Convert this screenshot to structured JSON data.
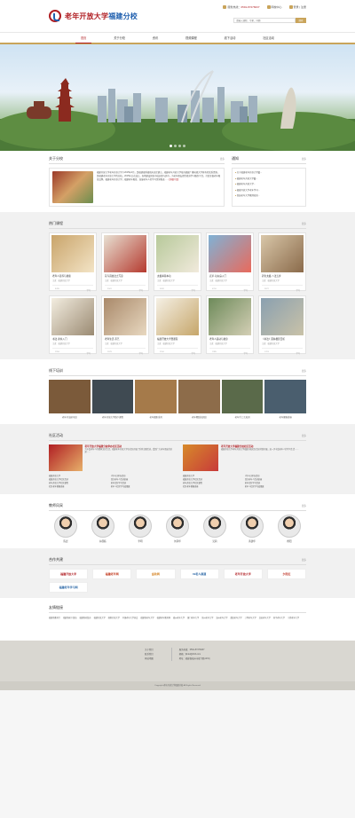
{
  "header": {
    "logo_title": "老年开放大学",
    "logo_sub": "福建分校",
    "phone_label": "服务热线：",
    "phone": "0591-87278237",
    "links": [
      "网校中心",
      "登录 | 注册"
    ],
    "search_placeholder": "请输入课程、专家、问题",
    "search_button": "搜索"
  },
  "nav": [
    "首页",
    "关于分校",
    "资讯",
    "视频课程",
    "线下活动",
    "社区活动"
  ],
  "about": {
    "title": "关于分校",
    "more": "更多",
    "text": "福建开放大学老年开放大学于2015年4月，是福建省委省政府决定建立，福建老年开放大学依托福建广播电视大学原有的优质资源，是福建老年开放大学的分校，2015年正式成立，各地建设团队中成员参与其中，为老年朋友提供终身学习服务平台，打造全省老年教育品牌，福建老年开放大学，福建老年教育，发展老年人的学习需求推进……",
    "read_more": "[详细介绍]"
  },
  "notice": {
    "title": "通知",
    "more": "更多",
    "items": [
      "关于福建老年开放大学暨...",
      "福建老年开放大学暨...",
      "福建老年开放大学...",
      "福建开放大学老年学习...",
      "首届老年大学教师培训..."
    ]
  },
  "courses": {
    "title": "热门课程",
    "more": "更多",
    "items": [
      {
        "t": "老年人营养与健康",
        "s": "主讲：福建开放大学",
        "v": "8435",
        "c": "学习"
      },
      {
        "t": "花鸟画技法之写意",
        "s": "主讲：福建开放大学",
        "v": "3341",
        "c": "学习"
      },
      {
        "t": "太极拳基本功",
        "s": "主讲：福建开放大学",
        "v": "5632",
        "c": "学习"
      },
      {
        "t": "武术·功夫扇入门",
        "s": "主讲：福建开放大学",
        "v": "4210",
        "c": "学习"
      },
      {
        "t": "养生太极·八法五步",
        "s": "主讲：福建开放大学",
        "v": "3672",
        "c": "学习"
      },
      {
        "t": "书法·隶书入门",
        "s": "主讲：福建开放大学",
        "v": "2934",
        "c": "学习"
      },
      {
        "t": "老年生活·茶艺",
        "s": "主讲：福建开放大学",
        "v": "2678",
        "c": "学习"
      },
      {
        "t": "福建开放大学暨课程",
        "s": "主讲：福建开放大学",
        "v": "2190",
        "c": "学习"
      },
      {
        "t": "老年人运动与健身",
        "s": "主讲：福建开放大学",
        "v": "1985",
        "c": "学习"
      },
      {
        "t": "《书法》园林摄影赏析",
        "s": "主讲：福建开放大学",
        "v": "1763",
        "c": "学习"
      }
    ]
  },
  "offline": {
    "title": "线下培训",
    "more": "更多",
    "items": [
      "老年书法研习班",
      "老年开放大学线下课程",
      "老年摄影采风",
      "老年舞蹈培训班",
      "老年手工艺培训",
      "老年健康讲座"
    ]
  },
  "community": {
    "title": "社区活动",
    "more": "更多",
    "left": {
      "h": "老年开放大学福建分校举办社区活动",
      "p": "为丰富老年人的精神文化生活，福建老年开放大学在社区开展了系列主题活动，受到广大老年朋友的欢迎……",
      "list": [
        "福建开放大学",
        "4月20日举办活动",
        "福建开放大学社区活动",
        "社区老年人活动讲座",
        "老年开放大学社区课程",
        "老年社区学习活动",
        "社区老年健康讲座",
        "老年人社区学习成果展"
      ]
    },
    "right": {
      "h": "老年开放大学福建分校社区活动",
      "p": "福建开放大学老年开放大学福建分校社区活动持续开展，进一步丰富老年人的学习生活……",
      "list": [
        "福建开放大学",
        "4月20日举办活动",
        "福建开放大学社区活动",
        "社区老年人活动讲座",
        "老年开放大学社区课程",
        "老年社区学习活动",
        "社区老年健康讲座",
        "老年人社区学习成果展"
      ]
    }
  },
  "teachers": {
    "title": "教师风采",
    "more": "更多",
    "items": [
      "陈晨",
      "林国栋",
      "李明",
      "刘丹华",
      "吴莉",
      "黄建华",
      "杨阳"
    ]
  },
  "partners": {
    "title": "合作共建",
    "more": "更多",
    "items": [
      "福建开放大学",
      "福建老年网",
      "金秋网",
      "39老人频道",
      "老年开放大学",
      "夕阳红",
      "福建老年学习网"
    ]
  },
  "links": {
    "title": "友情链接",
    "items": [
      "福建省教育厅",
      "福建省老干部局",
      "福建省老龄办",
      "福建开放大学",
      "国家开放大学",
      "中国老年大学协会",
      "福建省老年大学",
      "福建老年教育网",
      "福州老年大学",
      "厦门老年大学",
      "泉州老年大学",
      "漳州老年大学",
      "莆田老年大学",
      "三明老年大学",
      "龙岩老年大学",
      "南平老年大学",
      "宁德老年大学"
    ]
  },
  "footer": {
    "left": [
      "关于我们",
      "联系我们",
      "网站地图"
    ],
    "right": [
      "服务热线：0591-87278237",
      "邮箱：fjlnkd@163.com",
      "地址：福建省福州市福飞路123号"
    ],
    "copyright": "Copyright 老年开放大学福建分校 All Rights Reserved"
  }
}
